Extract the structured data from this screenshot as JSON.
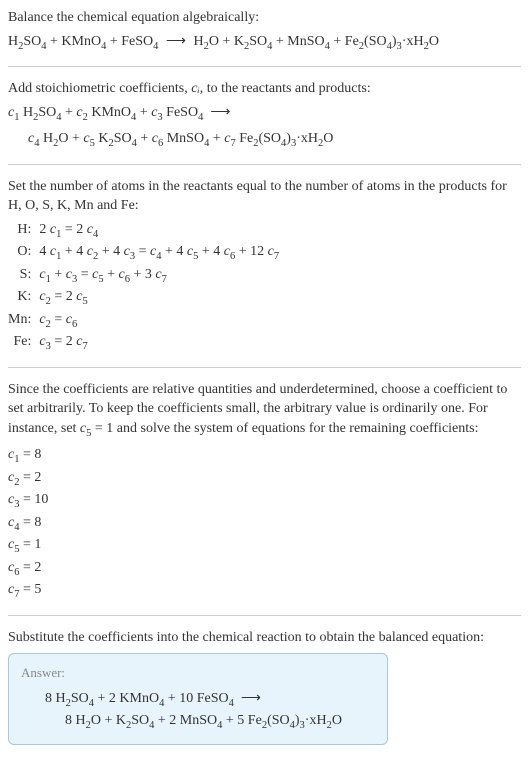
{
  "intro": {
    "line1": "Balance the chemical equation algebraically:",
    "eq_lhs": "H₂SO₄ + KMnO₄ + FeSO₄",
    "arrow": "⟶",
    "eq_rhs": "H₂O + K₂SO₄ + MnSO₄ + Fe₂(SO₄)₃·xH₂O"
  },
  "step1": {
    "text": "Add stoichiometric coefficients, ",
    "ci": "cᵢ",
    "text2": ", to the reactants and products:",
    "eq_line1": "c₁ H₂SO₄ + c₂ KMnO₄ + c₃ FeSO₄  ⟶",
    "eq_line2": "c₄ H₂O + c₅ K₂SO₄ + c₆ MnSO₄ + c₇ Fe₂(SO₄)₃·xH₂O"
  },
  "step2": {
    "text": "Set the number of atoms in the reactants equal to the number of atoms in the products for H, O, S, K, Mn and Fe:",
    "rows": [
      {
        "label": "H:",
        "eq": "2 c₁ = 2 c₄"
      },
      {
        "label": "O:",
        "eq": "4 c₁ + 4 c₂ + 4 c₃ = c₄ + 4 c₅ + 4 c₆ + 12 c₇"
      },
      {
        "label": "S:",
        "eq": "c₁ + c₃ = c₅ + c₆ + 3 c₇"
      },
      {
        "label": "K:",
        "eq": "c₂ = 2 c₅"
      },
      {
        "label": "Mn:",
        "eq": "c₂ = c₆"
      },
      {
        "label": "Fe:",
        "eq": "c₃ = 2 c₇"
      }
    ]
  },
  "step3": {
    "text": "Since the coefficients are relative quantities and underdetermined, choose a coefficient to set arbitrarily. To keep the coefficients small, the arbitrary value is ordinarily one. For instance, set c₅ = 1 and solve the system of equations for the remaining coefficients:",
    "coeffs": [
      "c₁ = 8",
      "c₂ = 2",
      "c₃ = 10",
      "c₄ = 8",
      "c₅ = 1",
      "c₆ = 2",
      "c₇ = 5"
    ]
  },
  "step4": {
    "text": "Substitute the coefficients into the chemical reaction to obtain the balanced equation:"
  },
  "answer": {
    "label": "Answer:",
    "line1": "8 H₂SO₄ + 2 KMnO₄ + 10 FeSO₄  ⟶",
    "line2": "8 H₂O + K₂SO₄ + 2 MnSO₄ + 5 Fe₂(SO₄)₃·xH₂O"
  },
  "chart_data": {
    "type": "table",
    "title": "Atom balance equations",
    "categories": [
      "H",
      "O",
      "S",
      "K",
      "Mn",
      "Fe"
    ],
    "equations": [
      "2 c1 = 2 c4",
      "4 c1 + 4 c2 + 4 c3 = c4 + 4 c5 + 4 c6 + 12 c7",
      "c1 + c3 = c5 + c6 + 3 c7",
      "c2 = 2 c5",
      "c2 = c6",
      "c3 = 2 c7"
    ],
    "solution": {
      "c1": 8,
      "c2": 2,
      "c3": 10,
      "c4": 8,
      "c5": 1,
      "c6": 2,
      "c7": 5
    }
  }
}
